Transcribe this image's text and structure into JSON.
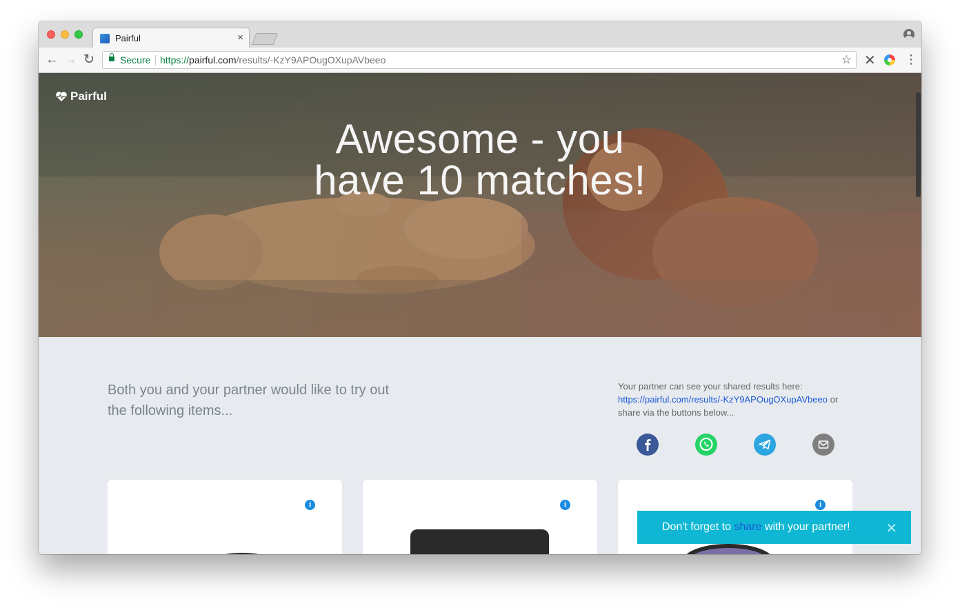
{
  "browser": {
    "tab_title": "Pairful",
    "tab_close": "×",
    "secure_label": "Secure",
    "url_scheme": "https://",
    "url_host": "pairful.com",
    "url_path": "/results/-KzY9APOugOXupAVbeeo",
    "icons": {
      "back": "arrow-left-icon",
      "forward": "arrow-right-icon",
      "reload": "reload-icon",
      "star": "star-icon",
      "menu": "kebab-menu-icon"
    }
  },
  "page": {
    "brand": "Pairful",
    "hero_title_line1": "Awesome - you",
    "hero_title_line2": "have 10 matches!",
    "intro": "Both you and your partner would like to try out the following items...",
    "share": {
      "text_before": "Your partner can see your shared results here:",
      "link": "https://pairful.com/results/-KzY9APOugOXupAVbeeo",
      "text_after_1": "or",
      "text_after_2": "share via the buttons below..."
    },
    "social_buttons": [
      {
        "name": "facebook",
        "color": "#3b5998"
      },
      {
        "name": "whatsapp",
        "color": "#25d366"
      },
      {
        "name": "telegram",
        "color": "#2ca5e0"
      },
      {
        "name": "email",
        "color": "#7f7f7f"
      }
    ],
    "info_icon_glyph": "i",
    "toast": {
      "before": "Don't forget to",
      "link": "share",
      "after": "with your partner!",
      "close": "✕"
    }
  },
  "colors": {
    "accent": "#0fb7d4",
    "link": "#1a5ad8",
    "page_bg": "#e7eaee"
  }
}
